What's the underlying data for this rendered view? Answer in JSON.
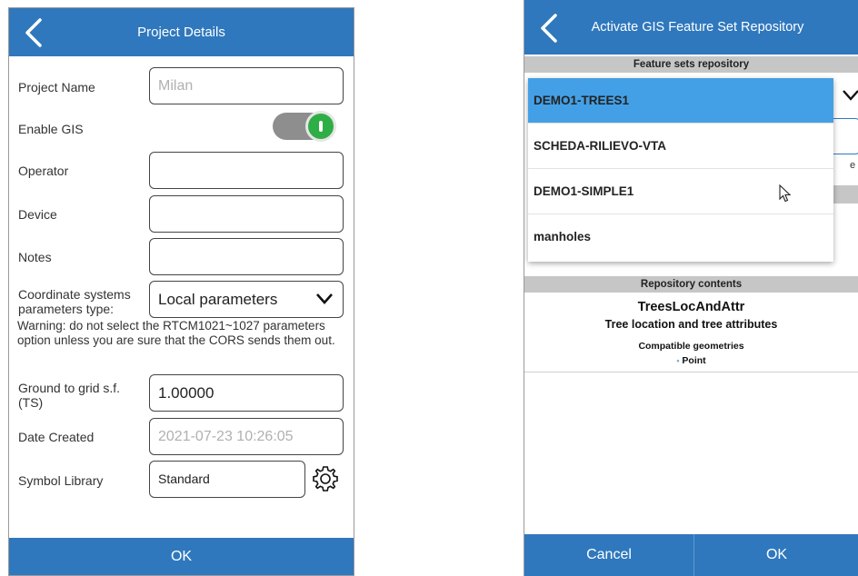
{
  "left": {
    "header": {
      "title": "Project Details"
    },
    "fields": {
      "project_name": {
        "label": "Project Name",
        "placeholder": "Milan"
      },
      "enable_gis": {
        "label": "Enable GIS",
        "state": "on"
      },
      "operator": {
        "label": "Operator",
        "value": ""
      },
      "device": {
        "label": "Device",
        "value": ""
      },
      "notes": {
        "label": "Notes",
        "value": ""
      },
      "coordinate_params": {
        "label": "Coordinate systems parameters type:",
        "value": "Local parameters"
      },
      "warning": "Warning: do not select the RTCM1021~1027 parameters option unless you are sure that the CORS sends them out.",
      "ground_to_grid": {
        "label": "Ground to grid s.f. (TS)",
        "value": "1.00000"
      },
      "date_created": {
        "label": "Date Created",
        "value": "2021-07-23 10:26:05"
      },
      "symbol_library": {
        "label": "Symbol Library",
        "value": "Standard"
      }
    },
    "footer": {
      "ok": "OK"
    }
  },
  "right": {
    "header": {
      "title": "Activate GIS Feature Set Repository"
    },
    "repo_section": "Feature sets repository",
    "dropdown_items": [
      {
        "label": "DEMO1-TREES1",
        "selected": true
      },
      {
        "label": "SCHEDA-RILIEVO-VTA",
        "selected": false
      },
      {
        "label": "DEMO1-SIMPLE1",
        "selected": false
      },
      {
        "label": "manholes",
        "selected": false
      }
    ],
    "peek_suffix": "e",
    "contents_section": "Repository contents",
    "contents": {
      "name": "TreesLocAndAttr",
      "description": "Tree location and tree attributes",
      "geometries_label": "Compatible geometries",
      "geometry": "Point"
    },
    "footer": {
      "cancel": "Cancel",
      "ok": "OK"
    }
  },
  "colors": {
    "accent": "#2f78bd",
    "selected_item": "#44a0e6",
    "toggle_on": "#2fae45",
    "section_bar": "#c6c6c6"
  }
}
